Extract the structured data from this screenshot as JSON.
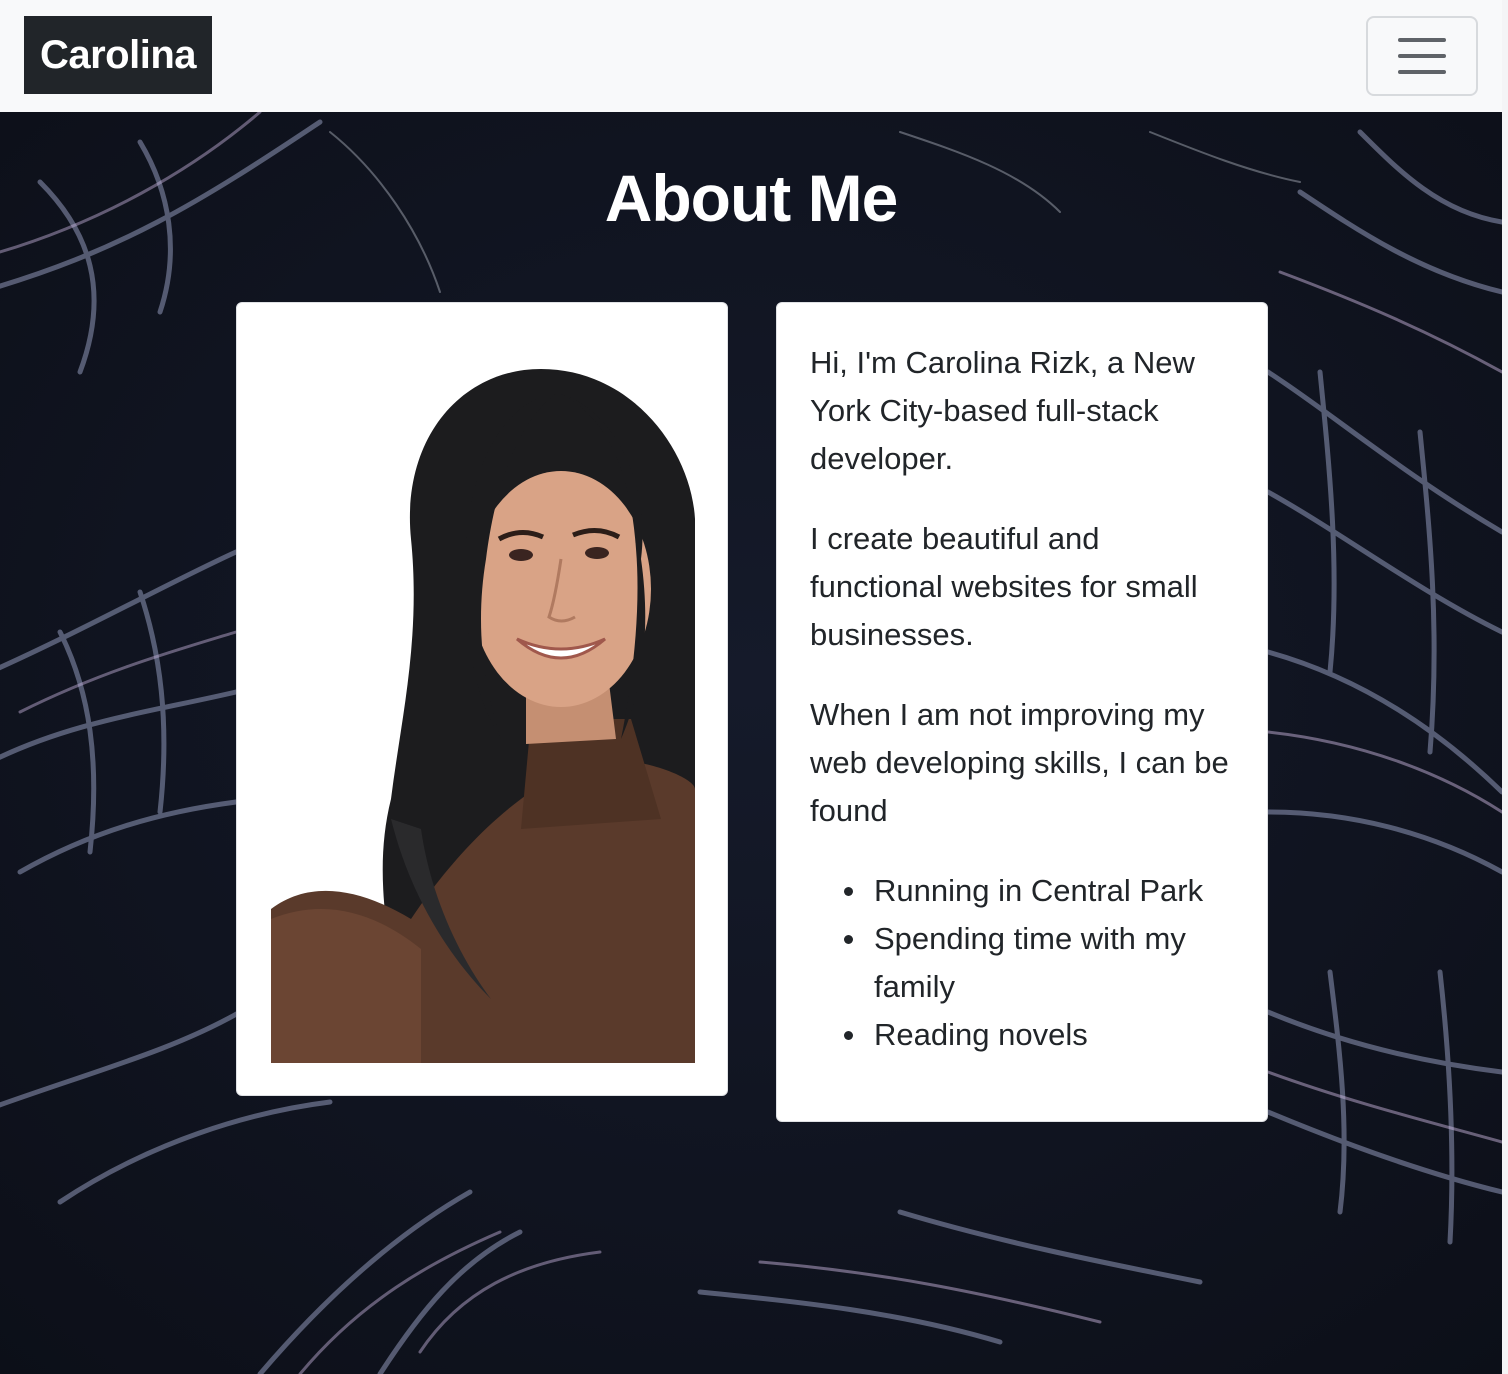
{
  "navbar": {
    "brand": "Carolina",
    "menu_icon": "hamburger-menu-icon"
  },
  "about": {
    "heading": "About Me",
    "photo_icon": "profile-photo",
    "paragraphs": [
      "Hi, I'm Carolina Rizk, a New York City-based full-stack developer.",
      "I create beautiful and functional websites for small businesses.",
      "When I am not improving my web developing skills, I can be found"
    ],
    "hobbies": [
      "Running in Central Park",
      "Spending time with my family",
      "Reading novels"
    ]
  },
  "colors": {
    "navbar_bg": "#f8f9fa",
    "brand_bg": "#212529",
    "hero_bg": "#111521",
    "card_bg": "#ffffff",
    "text": "#212529"
  }
}
